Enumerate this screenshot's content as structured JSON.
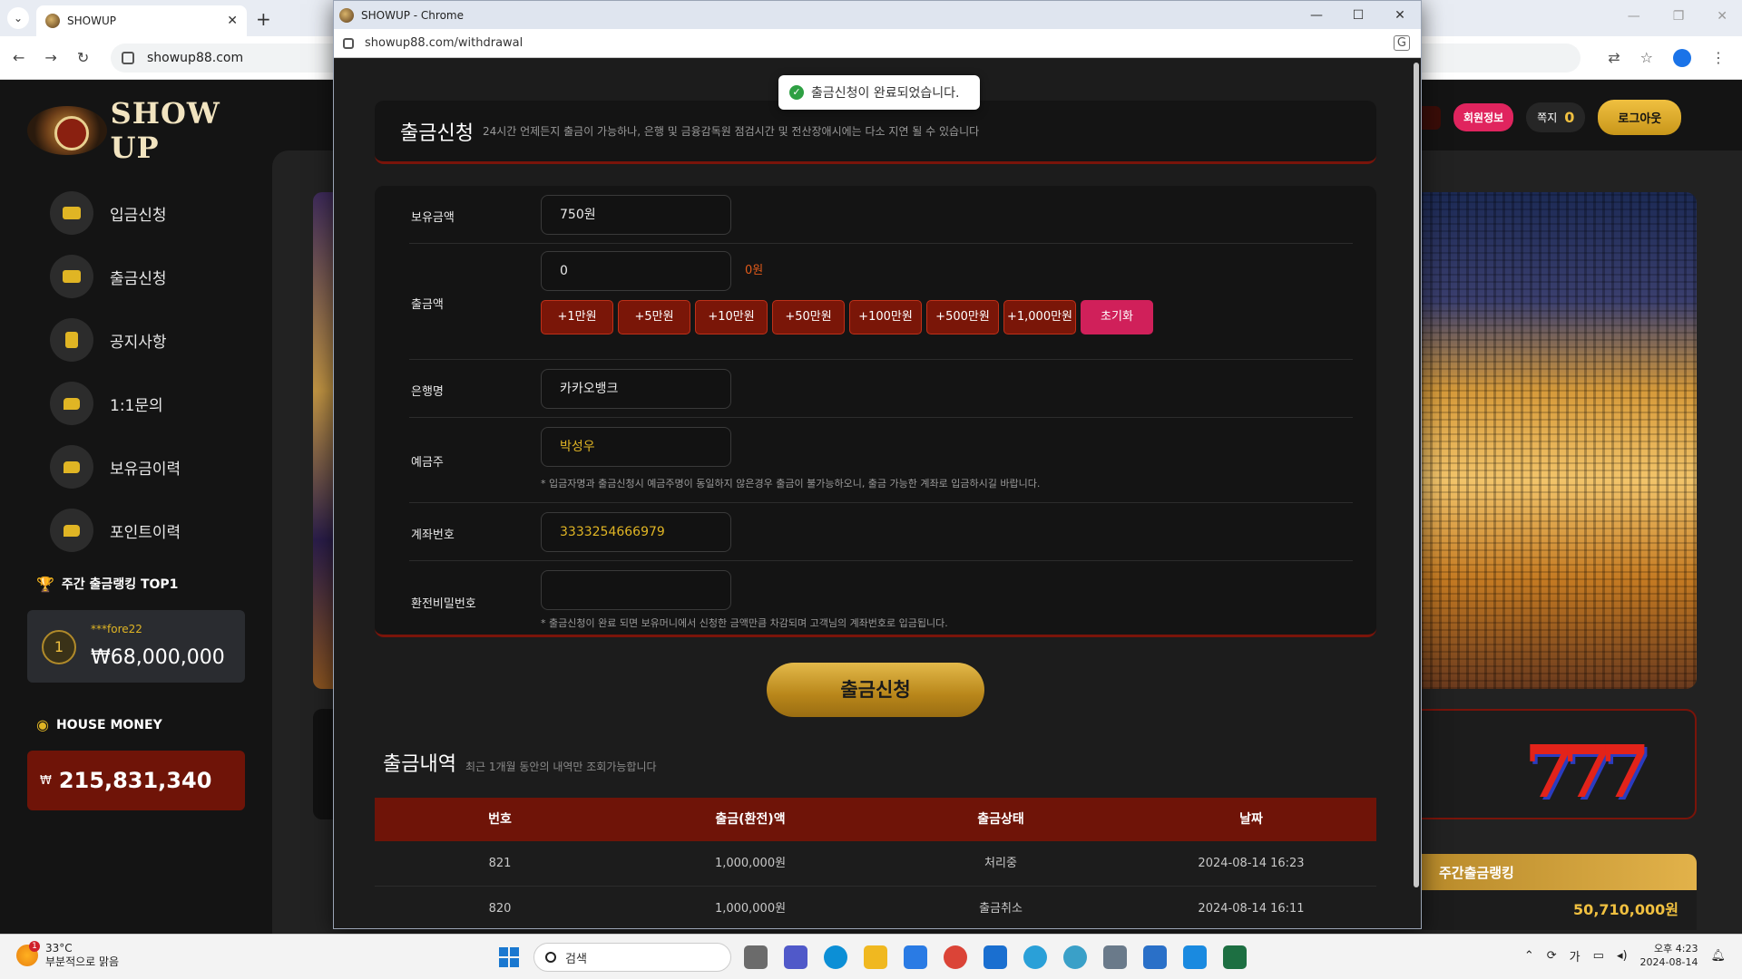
{
  "bg_browser": {
    "tab_title": "SHOWUP",
    "url": "showup88.com"
  },
  "site": {
    "logo_text": "SHOW UP",
    "menu": [
      {
        "label": "입금신청",
        "icon": "card-icon"
      },
      {
        "label": "출금신청",
        "icon": "card-icon"
      },
      {
        "label": "공지사항",
        "icon": "clipboard-icon"
      },
      {
        "label": "1:1문의",
        "icon": "chat-icon"
      },
      {
        "label": "보유금이력",
        "icon": "chat-icon"
      },
      {
        "label": "포인트이력",
        "icon": "chat-icon"
      }
    ],
    "rank_title": "주간 출금랭킹 TOP1",
    "rank": {
      "position": "1",
      "user": "***fore22",
      "amount": "₩68,000,000"
    },
    "house_title": "HOUSE MONEY",
    "house": {
      "currency": "₩",
      "value": "215,831,340"
    },
    "header": {
      "member_info": "회원정보",
      "note_label": "쪽지",
      "note_count": "0",
      "logout": "로그아웃"
    },
    "weekly_title": "주간출금랭킹",
    "weekly_amount": "50,710,000원"
  },
  "popup": {
    "window_title": "SHOWUP - Chrome",
    "url": "showup88.com/withdrawal",
    "toast": "출금신청이 완료되었습니다.",
    "heading": "출금신청",
    "heading_desc": "24시간 언제든지 출금이 가능하나, 은행 및 금융감독원 점검시간 및 전산장애시에는 다소 지연 될 수 있습니다",
    "form": {
      "balance_label": "보유금액",
      "balance_value": "750원",
      "amount_label": "출금액",
      "amount_value": "0",
      "amount_display": "0원",
      "chips": [
        "+1만원",
        "+5만원",
        "+10만원",
        "+50만원",
        "+100만원",
        "+500만원",
        "+1,000만원"
      ],
      "reset_label": "초기화",
      "bank_label": "은행명",
      "bank_value": "카카오뱅크",
      "holder_label": "예금주",
      "holder_value": "박성우",
      "holder_note": "* 입금자명과 출금신청시 예금주명이 동일하지 않은경우 출금이 불가능하오니, 출금 가능한 계좌로 입금하시길 바랍니다.",
      "account_label": "계좌번호",
      "account_value": "3333254666979",
      "password_label": "환전비밀번호",
      "password_value": "",
      "password_note": "* 출금신청이 완료 되면 보유머니에서 신청한 금액만큼 차감되며 고객님의 계좌번호로 입금됩니다."
    },
    "submit_label": "출금신청",
    "history_title": "출금내역",
    "history_desc": "최근 1개월 동안의 내역만 조회가능합니다",
    "table": {
      "headers": [
        "번호",
        "출금(환전)액",
        "출금상태",
        "날짜"
      ],
      "rows": [
        [
          "821",
          "1,000,000원",
          "처리중",
          "2024-08-14 16:23"
        ],
        [
          "820",
          "1,000,000원",
          "출금취소",
          "2024-08-14 16:11"
        ]
      ]
    }
  },
  "taskbar": {
    "weather_temp": "33°C",
    "weather_desc": "부분적으로 맑음",
    "weather_badge": "1",
    "search_placeholder": "검색",
    "ime": "가",
    "time": "오후 4:23",
    "date": "2024-08-14"
  }
}
